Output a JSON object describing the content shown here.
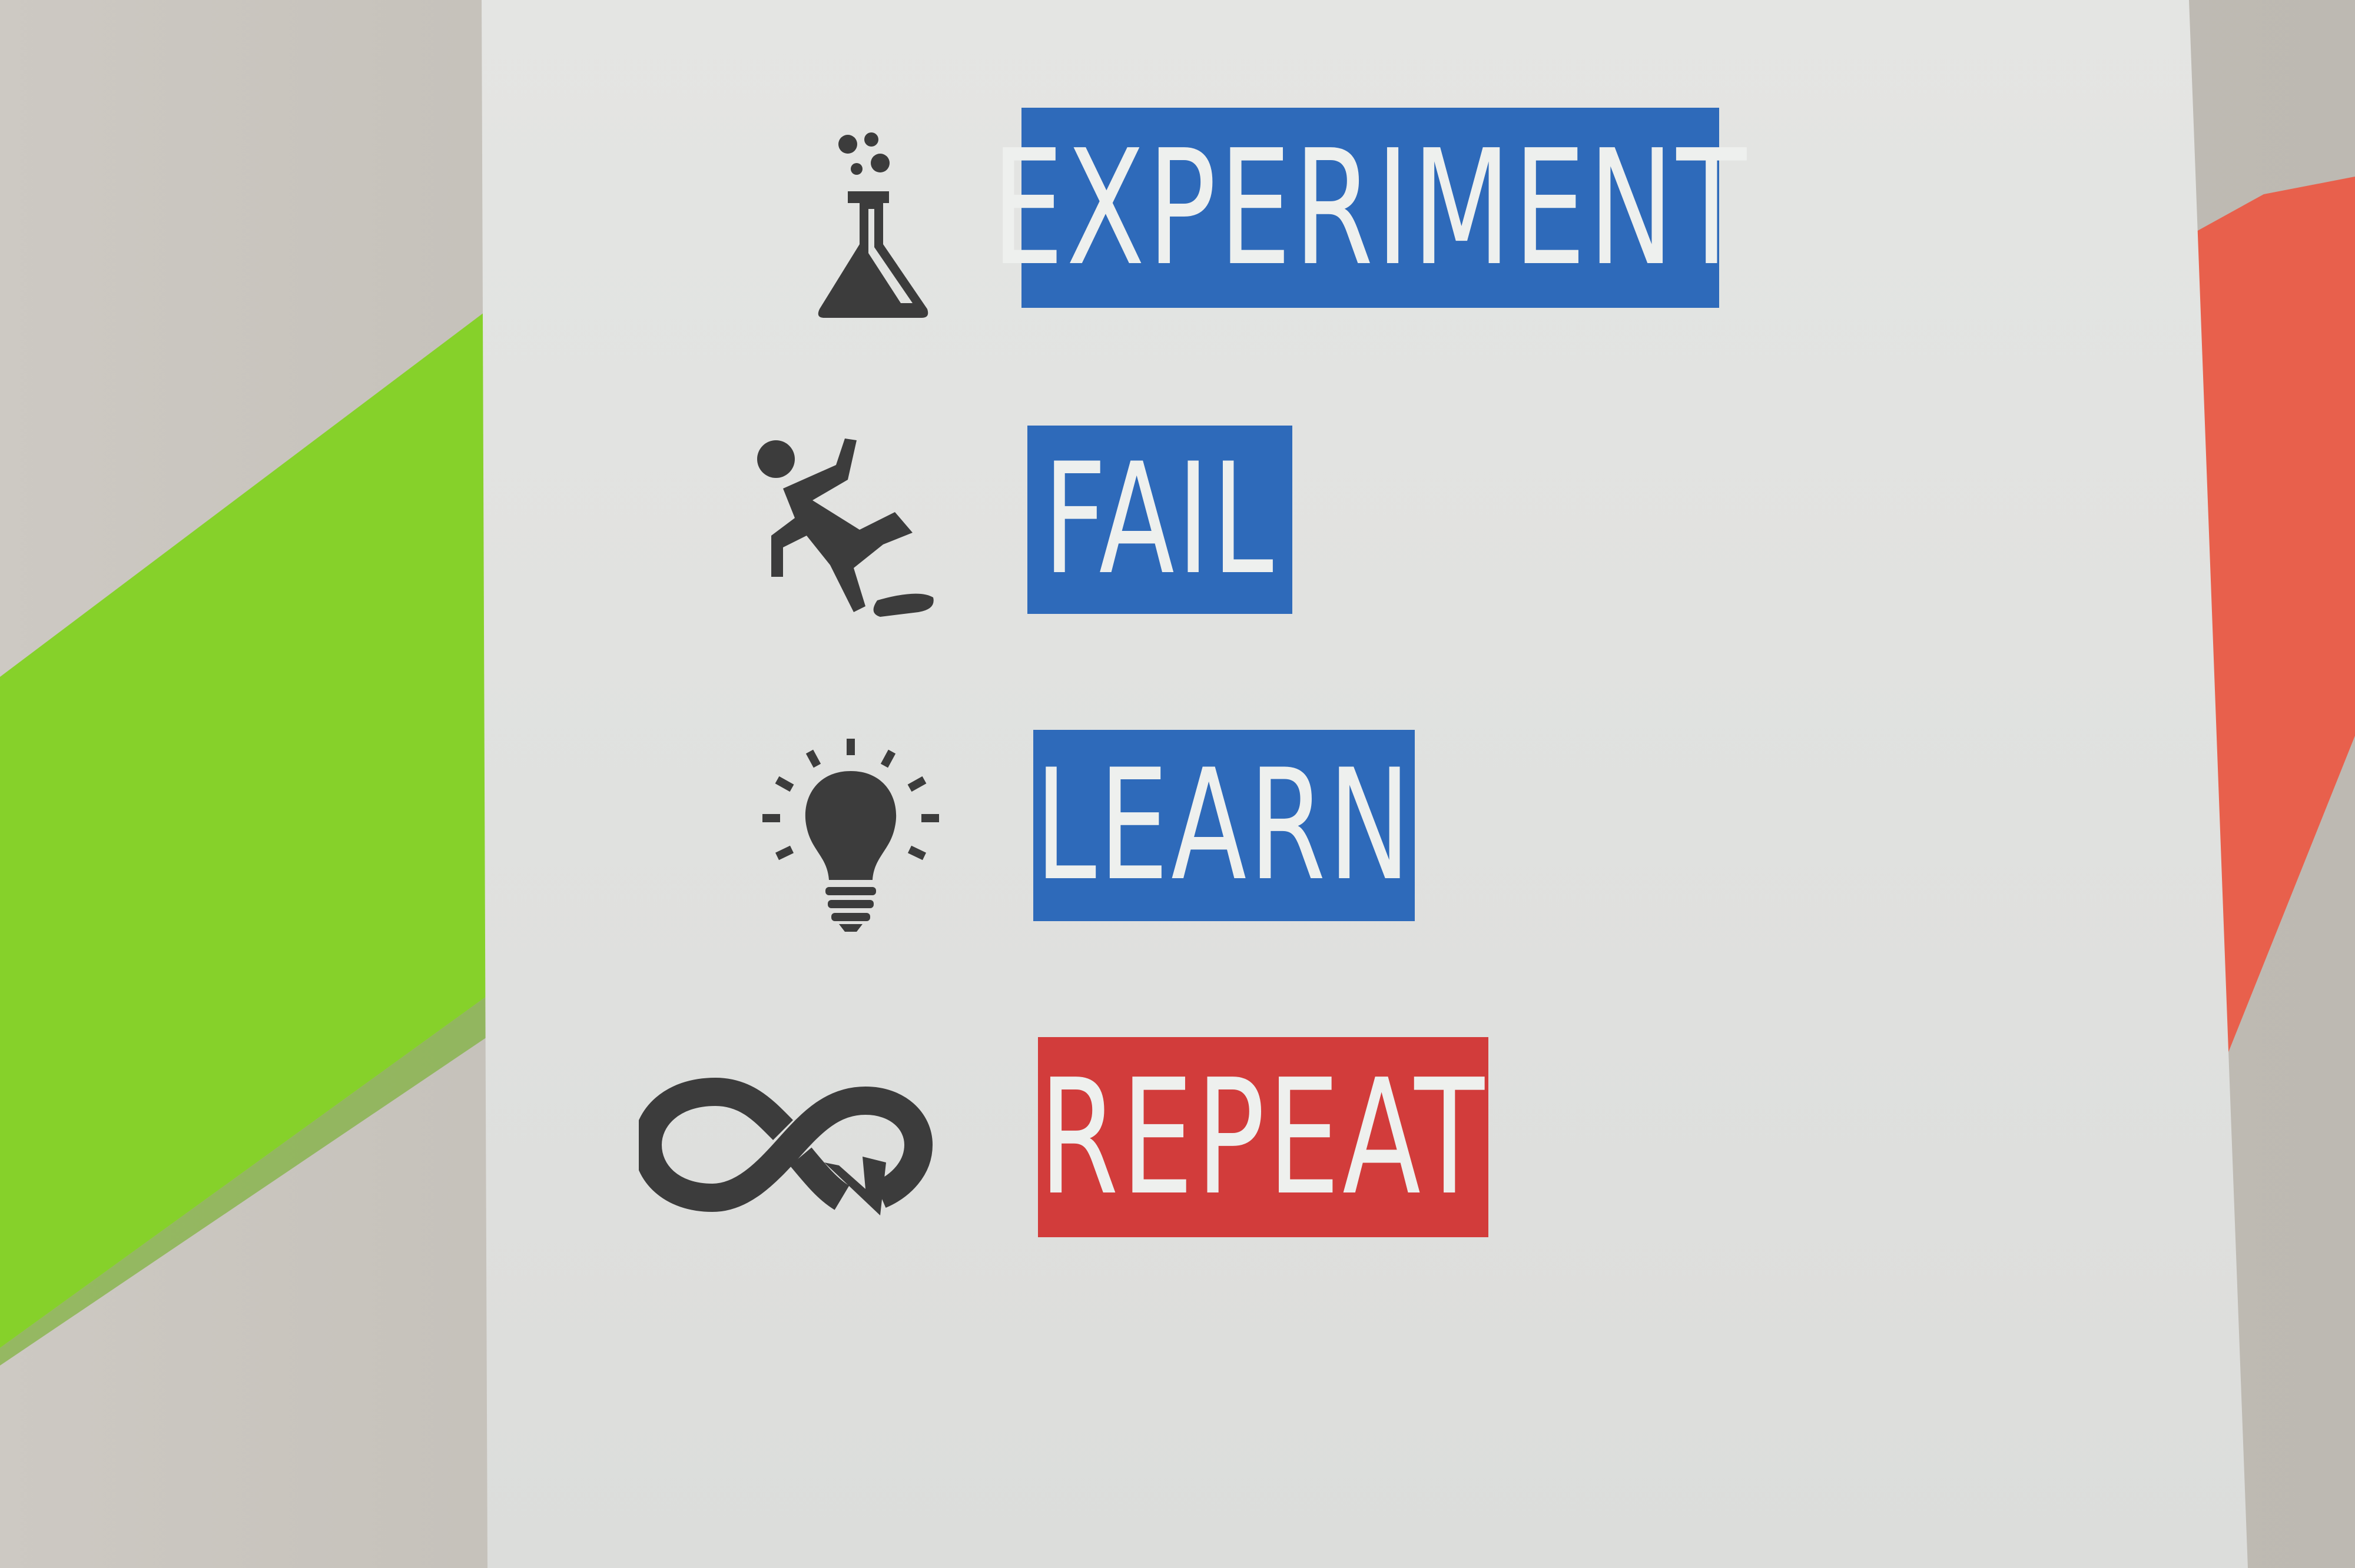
{
  "poster": {
    "items": [
      {
        "label": "EXPERIMENT",
        "icon": "flask-icon",
        "color": "#2e6aba"
      },
      {
        "label": "FAIL",
        "icon": "slipping-person-icon",
        "color": "#2e6aba"
      },
      {
        "label": "LEARN",
        "icon": "lightbulb-icon",
        "color": "#2e6aba"
      },
      {
        "label": "REPEAT",
        "icon": "infinity-loop-icon",
        "color": "#d23c3b"
      }
    ]
  },
  "colors": {
    "green_stripe": "#86d12a",
    "red_stripe": "#e8604c",
    "poster_background": "#e2e3e1",
    "icon_fill": "#3c3c3c"
  }
}
